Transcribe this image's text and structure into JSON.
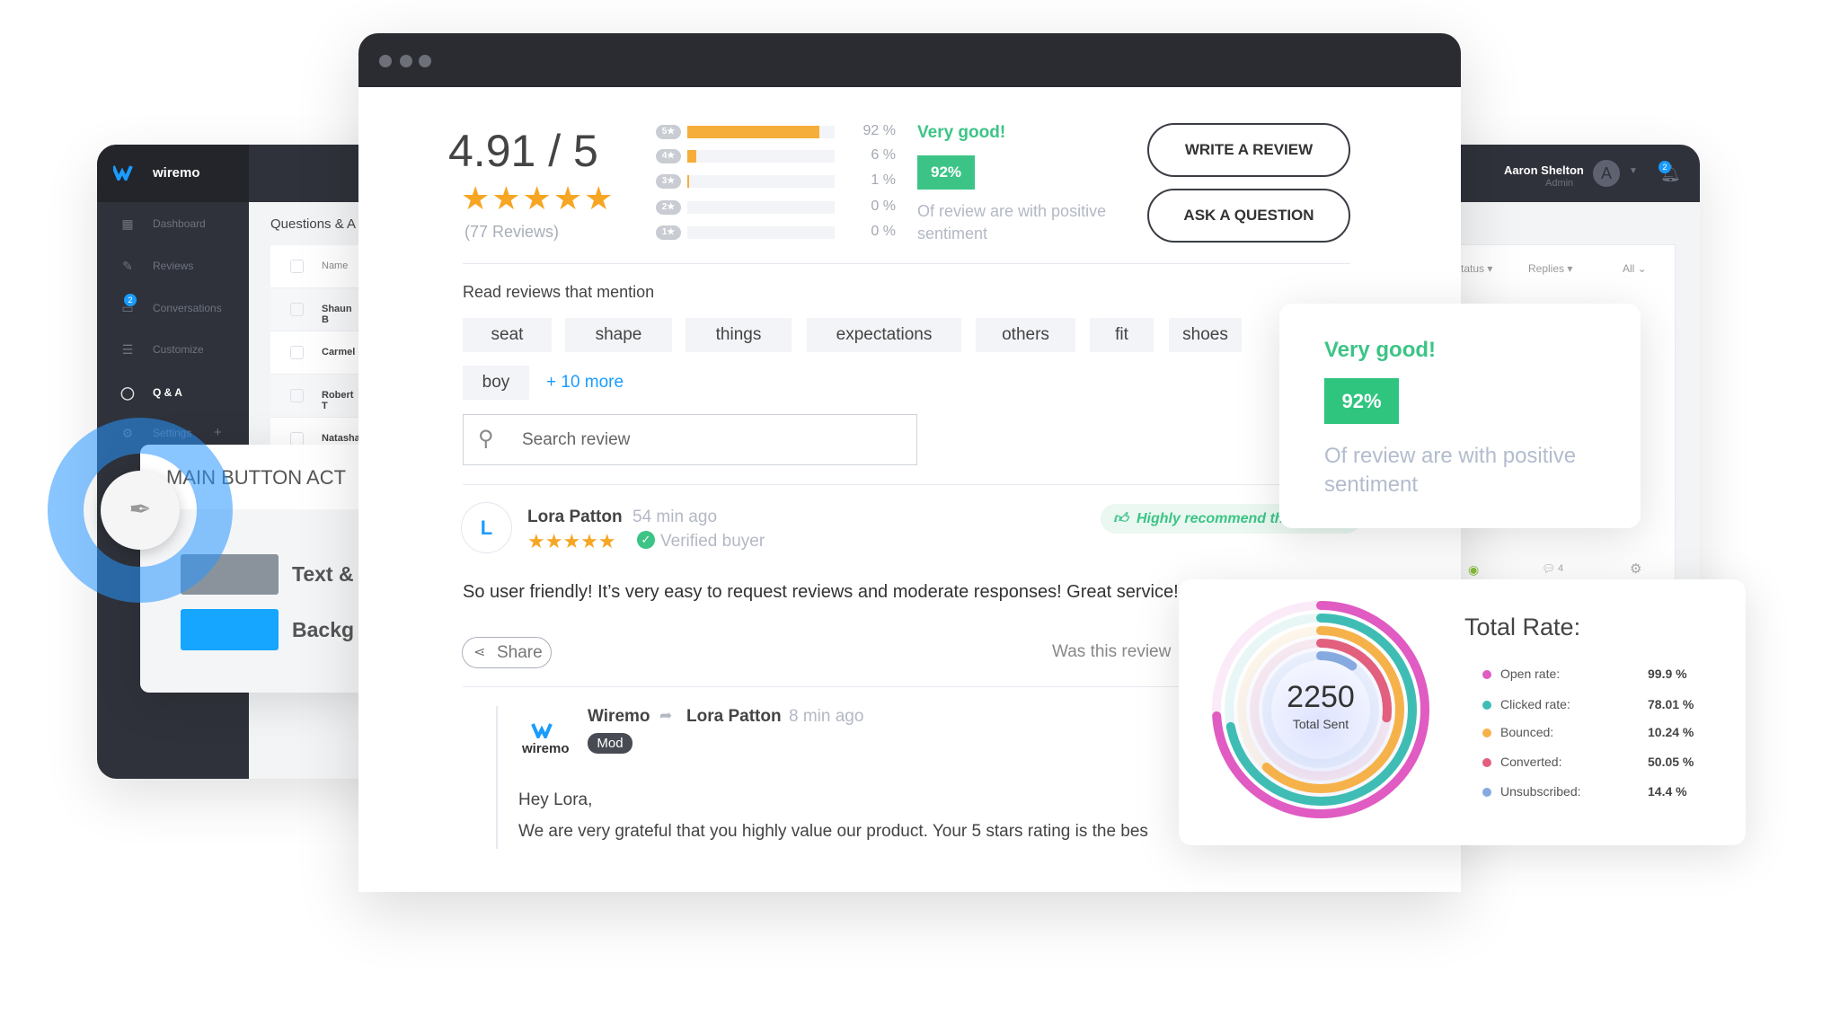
{
  "dashboard": {
    "brand": "wiremo",
    "sidebar": [
      {
        "label": "Dashboard",
        "icon": "grid-icon"
      },
      {
        "label": "Reviews",
        "icon": "edit-icon"
      },
      {
        "label": "Conversations",
        "icon": "chat-icon",
        "badge": "2"
      },
      {
        "label": "Customize",
        "icon": "sliders-icon"
      },
      {
        "label": "Q & A",
        "icon": "speech-bubble-icon"
      },
      {
        "label": "Settings",
        "icon": "gear-icon",
        "extra": "+"
      }
    ],
    "page_title": "Questions & A",
    "table": {
      "header": "Name",
      "rows": [
        "Shaun B",
        "Carmel",
        "Robert T",
        "Natasha"
      ],
      "filters": [
        "tatus ▾",
        "Replies ▾",
        "All ⌄"
      ],
      "row_meta": "4"
    },
    "user": {
      "name": "Aaron Shelton",
      "role": "Admin",
      "initial": "A",
      "notifications": "2"
    }
  },
  "button_panel": {
    "title": "MAIN BUTTON ACT",
    "options": [
      {
        "label": "Text &",
        "color": "#8a939c"
      },
      {
        "label": "Backg",
        "color": "#16a5ff"
      }
    ]
  },
  "summary": {
    "rating": "4.91 / 5",
    "stars": 5,
    "review_count": "(77 Reviews)",
    "distribution": [
      {
        "star": "5",
        "pct": 92,
        "label": "92 %"
      },
      {
        "star": "4",
        "pct": 6,
        "label": "6 %"
      },
      {
        "star": "3",
        "pct": 1,
        "label": "1 %"
      },
      {
        "star": "2",
        "pct": 0,
        "label": "0 %"
      },
      {
        "star": "1",
        "pct": 0,
        "label": "0 %"
      }
    ],
    "sentiment_title": "Very good!",
    "sentiment_pct": "92%",
    "sentiment_text": "Of review are with positive sentiment",
    "write_review": "WRITE A REVIEW",
    "ask_question": "ASK A QUESTION"
  },
  "mentions": {
    "title": "Read reviews that mention",
    "tags": [
      "seat",
      "shape",
      "things",
      "expectations",
      "others",
      "fit",
      "shoes",
      "boy"
    ],
    "more": "+ 10 more"
  },
  "search": {
    "placeholder": "Search review"
  },
  "review": {
    "initial": "L",
    "author": "Lora Patton",
    "time": "54 min ago",
    "stars": 5,
    "verified": "Verified buyer",
    "recommend": "Highly recommend this",
    "text": "So user friendly! It’s very easy to request reviews and moderate responses! Great service!",
    "share": "Share",
    "helpful": "Was this review"
  },
  "reply": {
    "logo_text": "wiremo",
    "author": "Wiremo",
    "to": "Lora Patton",
    "time": "8 min ago",
    "badge": "Mod",
    "greeting": "Hey Lora,",
    "text": "We are very grateful that you highly value our product. Your 5 stars rating is the bes"
  },
  "sentiment_card": {
    "title": "Very good!",
    "pct": "92%",
    "text": "Of review are with positive sentiment"
  },
  "chart_data": {
    "type": "radial-bar",
    "center_value": "2250",
    "center_label": "Total Sent",
    "title": "Total Rate:",
    "series": [
      {
        "name": "Open rate:",
        "value": 99.9,
        "label": "99.9 %",
        "color": "#e05bc2"
      },
      {
        "name": "Clicked rate:",
        "value": 78.01,
        "label": "78.01 %",
        "color": "#3fbdb5"
      },
      {
        "name": "Bounced:",
        "value": 10.24,
        "label": "10.24 %",
        "color": "#f6b24a"
      },
      {
        "name": "Converted:",
        "value": 50.05,
        "label": "50.05 %",
        "color": "#e2607e"
      },
      {
        "name": "Unsubscribed:",
        "value": 14.4,
        "label": "14.4 %",
        "color": "#86a9e0"
      }
    ]
  },
  "colors": {
    "accent": "#16a5ff",
    "green": "#3cc486",
    "star": "#f6a623",
    "dark": "#2f323a"
  }
}
